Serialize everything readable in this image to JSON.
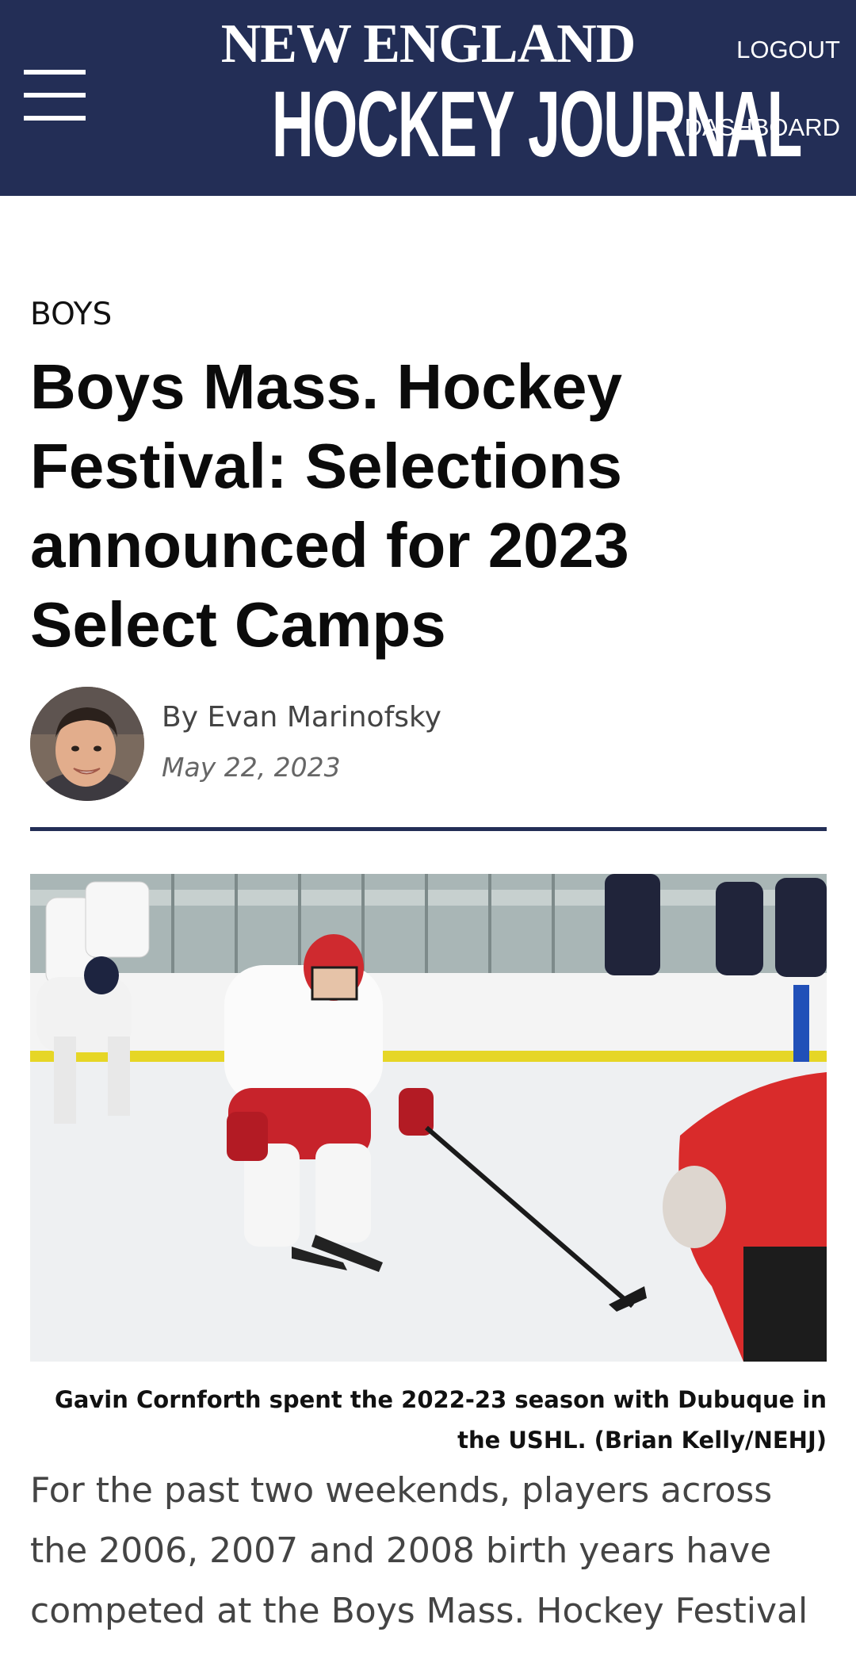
{
  "header": {
    "logo_top": "NEW ENGLAND",
    "logo_bottom": "HOCKEY JOURNAL",
    "logout_label": "LOGOUT",
    "dashboard_label": "DASHBOARD",
    "background_color": "#232e56"
  },
  "article": {
    "category": "BOYS",
    "title": "Boys Mass. Hockey Festival: Selections announced for 2023 Select Camps",
    "author": "By Evan Marinofsky",
    "date": "May 22, 2023",
    "photo_caption": "Gavin Cornforth spent the 2022-23 season with Dubuque in the USHL. (Brian Kelly/NEHJ)",
    "body_start": "For the past two weekends, players across the 2006, 2007 and 2008 birth years have competed at the Boys Mass. Hockey Festival"
  },
  "icons": {
    "menu": "hamburger-menu-icon"
  }
}
